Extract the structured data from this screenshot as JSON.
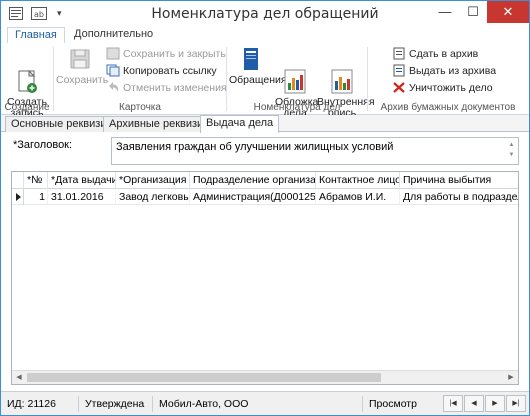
{
  "window": {
    "title": "Номенклатура дел обращений"
  },
  "ribbon_tabs": [
    {
      "label": "Главная",
      "active": true
    },
    {
      "label": "Дополнительно",
      "active": false
    }
  ],
  "ribbon": {
    "groups": {
      "create": {
        "label": "Создание",
        "create_record": "Создать\nзапись"
      },
      "card": {
        "label": "Карточка",
        "save": "Сохранить",
        "save_and_close": "Сохранить и закрыть",
        "copy_link": "Копировать ссылку",
        "cancel_changes": "Отменить изменения"
      },
      "nomenclature": {
        "label": "Номенклатура дел",
        "requests": "Обращения",
        "case_cover": "Обложка\nдела",
        "internal_inventory": "Внутренняя\nопись"
      },
      "archive": {
        "label": "Архив бумажных документов",
        "hand_over": "Сдать в архив",
        "issue_from": "Выдать из архива",
        "destroy": "Уничтожить дело"
      }
    }
  },
  "doc_tabs": [
    {
      "label": "Основные реквизиты",
      "active": false
    },
    {
      "label": "Архивные реквизиты",
      "active": false
    },
    {
      "label": "Выдача дела",
      "active": true
    }
  ],
  "form": {
    "title_label": "*Заголовок:",
    "title_value": "Заявления граждан об улучшении жилищных условий"
  },
  "grid": {
    "columns": [
      "*№",
      "*Дата выдачи",
      "*Организация",
      "Подразделение организации",
      "Контактное лицо",
      "Причина выбытия"
    ],
    "rows": [
      [
        "1",
        "31.01.2016",
        "Завод легковых...",
        "Администрация(Д000125)",
        "Абрамов И.И.",
        "Для работы в подразделе..."
      ]
    ]
  },
  "status": {
    "id": "ИД: 21126",
    "state": "Утверждена",
    "org": "Мобил-Авто, ООО",
    "mode": "Просмотр"
  },
  "colors": {
    "accent": "#1f5da8",
    "close": "#c7372f",
    "border": "#3b8fd6"
  }
}
